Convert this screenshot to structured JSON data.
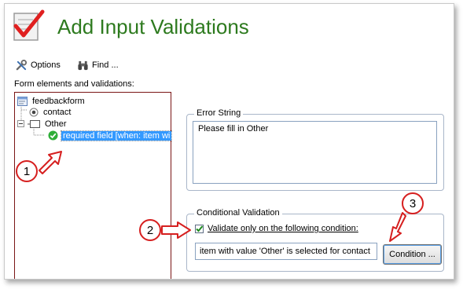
{
  "header": {
    "title": "Add Input Validations"
  },
  "toolbar": {
    "options_label": "Options",
    "find_label": "Find ..."
  },
  "tree": {
    "label": "Form elements and validations:",
    "nodes": [
      {
        "label": "feedbackform",
        "icon": "form-icon"
      },
      {
        "label": "contact",
        "icon": "radio-icon"
      },
      {
        "label": "Other",
        "icon": "field-icon"
      },
      {
        "label": "required field [when: item wi",
        "icon": "check-green-icon",
        "selected": true
      }
    ]
  },
  "error_string": {
    "legend": "Error String",
    "value": "Please fill in Other"
  },
  "conditional": {
    "legend": "Conditional Validation",
    "checkbox_label": "Validate only on the following condition:",
    "checked": true,
    "condition_value": "item with value 'Other' is selected for contact",
    "button_label": "Condition ..."
  },
  "callouts": [
    "1",
    "2",
    "3"
  ],
  "colors": {
    "title": "#2d7a1e",
    "callout": "#d61f1f",
    "selection": "#3399ff"
  }
}
